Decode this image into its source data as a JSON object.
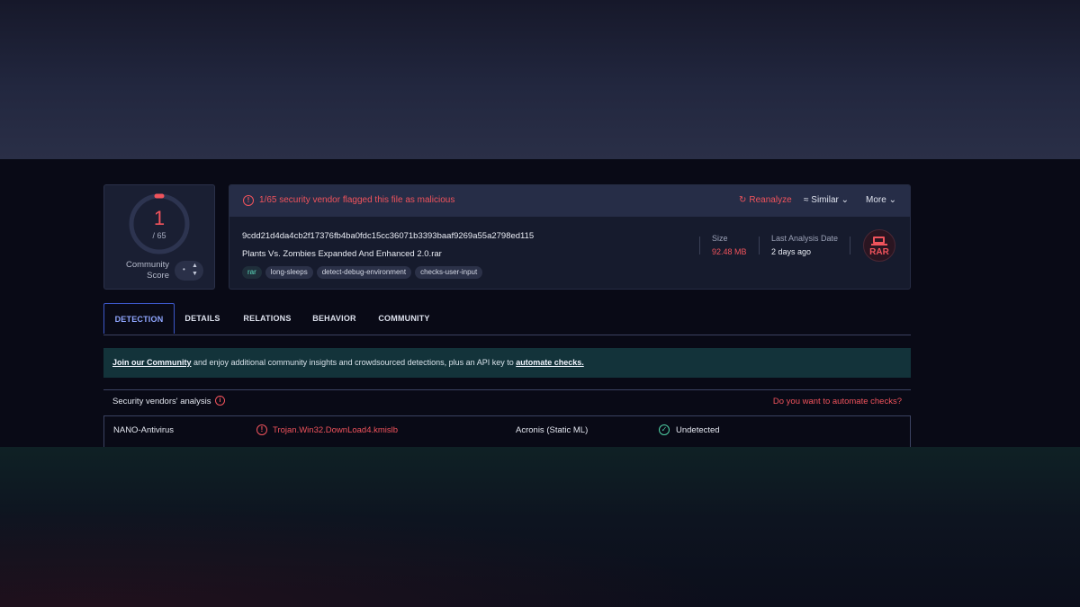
{
  "score": {
    "detected": "1",
    "total": "/ 65",
    "community_label_line1": "Community",
    "community_label_line2": "Score",
    "vote_value": "•"
  },
  "alert": {
    "text": "1/65 security vendor flagged this file as malicious"
  },
  "actions": {
    "reanalyze": "Reanalyze",
    "similar": "Similar",
    "more": "More"
  },
  "file": {
    "hash": "9cdd21d4da4cb2f17376fb4ba0fdc15cc36071b3393baaf9269a55a2798ed115",
    "name": "Plants Vs. Zombies Expanded And Enhanced 2.0.rar",
    "tags": [
      "rar",
      "long-sleeps",
      "detect-debug-environment",
      "checks-user-input"
    ],
    "size_label": "Size",
    "size_value": "92.48 MB",
    "date_label": "Last Analysis Date",
    "date_value": "2 days ago",
    "type_badge": "RAR"
  },
  "tabs": [
    {
      "label": "DETECTION",
      "active": true
    },
    {
      "label": "DETAILS",
      "active": false
    },
    {
      "label": "RELATIONS",
      "active": false
    },
    {
      "label": "BEHAVIOR",
      "active": false
    },
    {
      "label": "COMMUNITY",
      "active": false
    }
  ],
  "banner": {
    "link1": "Join our Community",
    "middle": " and enjoy additional community insights and crowdsourced detections, plus an API key to ",
    "link2": "automate checks."
  },
  "analysis": {
    "title": "Security vendors' analysis",
    "cta": "Do you want to automate checks?",
    "rows": [
      {
        "vendor1": "NANO-Antivirus",
        "result1": "Trojan.Win32.DownLoad4.kmislb",
        "vendor2": "Acronis (Static ML)",
        "result2": "Undetected"
      }
    ]
  },
  "colors": {
    "accent_red": "#f0535c",
    "accent_green": "#4fd1a5",
    "tab_active": "#8fa6ff"
  }
}
